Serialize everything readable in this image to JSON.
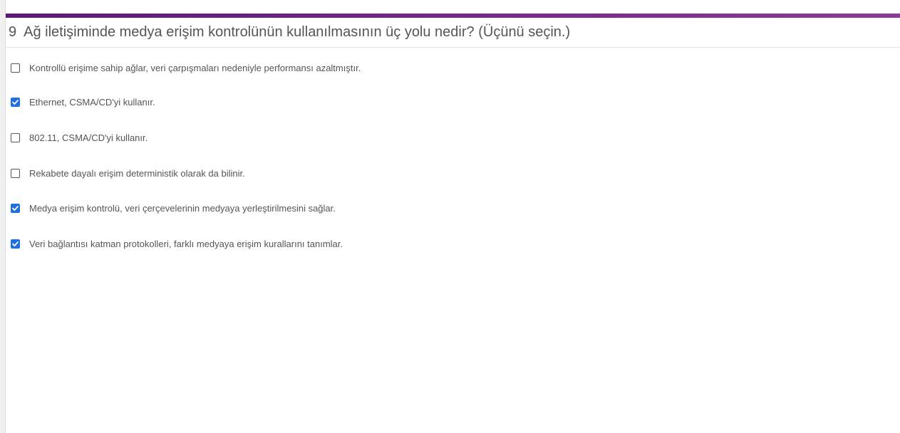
{
  "question": {
    "number": "9",
    "text": "Ağ iletişiminde medya erişim kontrolünün kullanılmasının üç yolu nedir? (Üçünü seçin.)"
  },
  "options": [
    {
      "label": "Kontrollü erişime sahip ağlar, veri çarpışmaları nedeniyle performansı azaltmıştır.",
      "checked": false
    },
    {
      "label": "Ethernet, CSMA/CD'yi kullanır.",
      "checked": true
    },
    {
      "label": "802.11, CSMA/CD'yi kullanır.",
      "checked": false
    },
    {
      "label": "Rekabete dayalı erişim deterministik olarak da bilinir.",
      "checked": false
    },
    {
      "label": "Medya erişim kontrolü, veri çerçevelerinin medyaya yerleştirilmesini sağlar.",
      "checked": true
    },
    {
      "label": "Veri bağlantısı katman protokolleri, farklı medyaya erişim kurallarını tanımlar.",
      "checked": true
    }
  ],
  "colors": {
    "accent": "#7a2a8c",
    "checkbox_checked": "#1f6fe0",
    "text": "#555555"
  },
  "icons": {
    "checkbox_mark": "checkmark-icon"
  }
}
